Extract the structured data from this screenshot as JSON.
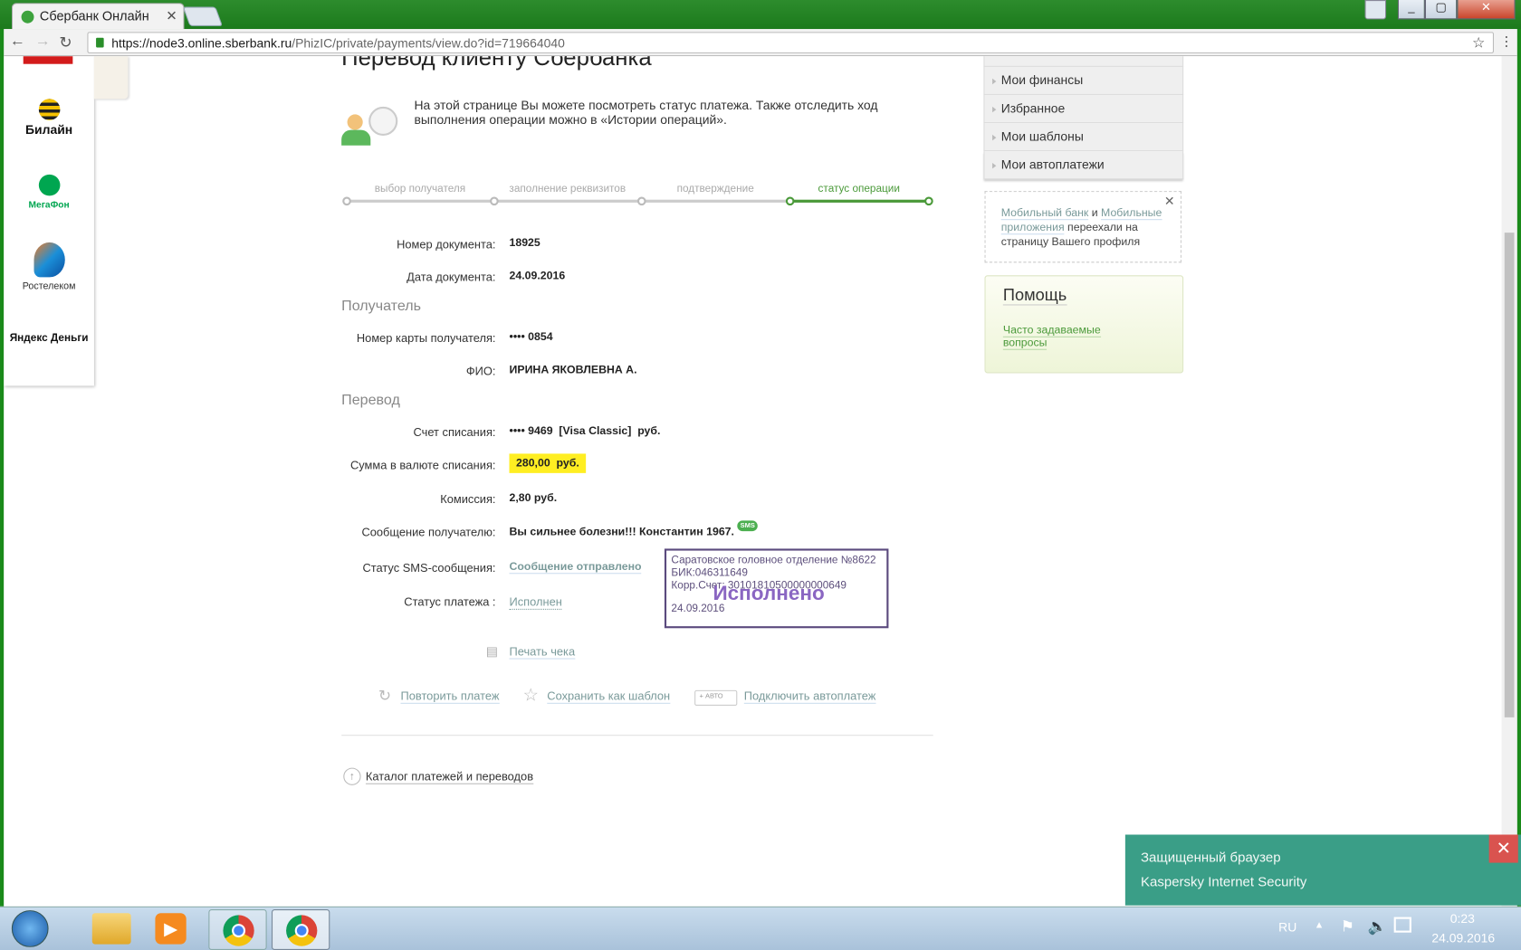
{
  "browser": {
    "tab_title": "Сбербанк Онлайн",
    "url_host": "https://node3.online.sberbank.ru",
    "url_path": "/PhizIC/private/payments/view.do?id=719664040"
  },
  "providers": [
    "Билайн",
    "МегаФон",
    "Ростелеком",
    "Яндекс Деньги"
  ],
  "page": {
    "title": "Перевод клиенту Сбербанка",
    "intro": "На этой странице Вы можете посмотреть статус платежа. Также отследить ход выполнения операции можно в «Истории операций».",
    "steps": [
      {
        "label": "выбор получателя",
        "active": false
      },
      {
        "label": "заполнение реквизитов",
        "active": false
      },
      {
        "label": "подтверждение",
        "active": false
      },
      {
        "label": "статус операции",
        "active": true
      }
    ],
    "fields": {
      "doc_number": {
        "label": "Номер документа:",
        "value": "18925"
      },
      "doc_date": {
        "label": "Дата документа:",
        "value": "24.09.2016"
      },
      "recipient_section": "Получатель",
      "card": {
        "label": "Номер карты получателя:",
        "value": "•••• 0854"
      },
      "fio": {
        "label": "ФИО:",
        "value": "ИРИНА ЯКОВЛЕВНА А."
      },
      "transfer_section": "Перевод",
      "account": {
        "label": "Счет списания:",
        "value": "•••• 9469  [Visa Classic]  руб."
      },
      "amount": {
        "label": "Сумма в валюте списания:",
        "value": "280,00  руб."
      },
      "fee": {
        "label": "Комиссия:",
        "value": "2,80 руб."
      },
      "message": {
        "label": "Сообщение получателю:",
        "value": "Вы сильнее болезни!!! Константин 1967.",
        "badge": "SMS"
      },
      "sms_status": {
        "label": "Статус SMS-сообщения:",
        "value": "Сообщение отправлено"
      },
      "pay_status": {
        "label": "Статус платежа :",
        "value": "Исполнен"
      }
    },
    "stamp": {
      "line1": "Саратовское головное отделение №8622",
      "line2": "БИК:046311649",
      "line3": "Корр.Счет: 30101810500000000649",
      "big": "Исполнено",
      "date": "24.09.2016"
    },
    "print": "Печать чека",
    "actions": {
      "repeat": "Повторить платеж",
      "save": "Сохранить как шаблон",
      "auto_badge": "+ АВТО",
      "auto": "Подключить автоплатеж"
    },
    "catalog": "Каталог платежей и переводов"
  },
  "sidebar": {
    "menu": [
      "Мои финансы",
      "Избранное",
      "Мои шаблоны",
      "Мои автоплатежи"
    ],
    "tip": {
      "link1": "Мобильный банк",
      "and": " и ",
      "link2": "Мобильные приложения",
      "rest": " переехали на страницу Вашего профиля"
    },
    "help": {
      "title": "Помощь",
      "faq": "Часто задаваемые вопросы"
    }
  },
  "kaspersky": {
    "line1": "Защищенный браузер",
    "line2": "Kaspersky Internet Security"
  },
  "taskbar": {
    "lang": "RU",
    "time": "0:23",
    "date": "24.09.2016"
  },
  "colors": {
    "accent": "#4b9a3a",
    "highlight": "#ffee22",
    "stamp": "#5b4a7e",
    "kaspersky": "#3a9e87"
  }
}
